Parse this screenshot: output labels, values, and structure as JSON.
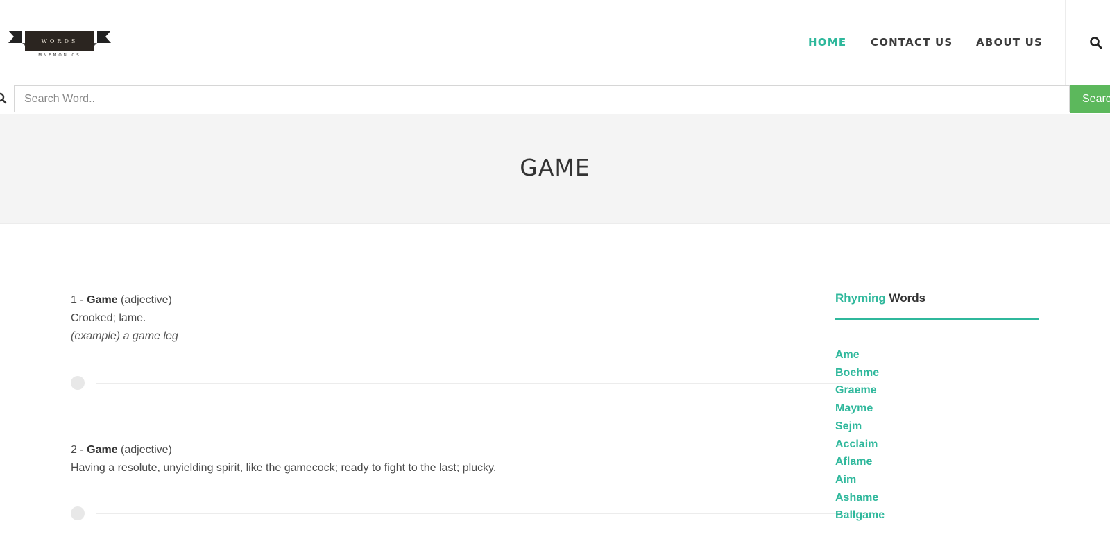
{
  "logo": {
    "top_text": "WORDS",
    "bottom_text": "MNEMONICS"
  },
  "nav": [
    {
      "label": "HOME",
      "active": true
    },
    {
      "label": "CONTACT US",
      "active": false
    },
    {
      "label": "ABOUT US",
      "active": false
    }
  ],
  "search": {
    "placeholder": "Search Word..",
    "button_label": "Search",
    "icon": "search-icon"
  },
  "page_title": "GAME",
  "definitions": [
    {
      "num_prefix": "1 - ",
      "word": "Game",
      "pos": " (adjective)",
      "meaning": "Crooked; lame.",
      "example": "(example) a game leg"
    },
    {
      "num_prefix": "2 - ",
      "word": "Game",
      "pos": " (adjective)",
      "meaning": "Having a resolute, unyielding spirit, like the gamecock; ready to fight to the last; plucky.",
      "example": ""
    }
  ],
  "sidebar": {
    "title_accent": "Rhyming",
    "title_rest": " Words",
    "rhymes": [
      "Ame",
      "Boehme",
      "Graeme",
      "Mayme",
      "Sejm",
      "Acclaim",
      "Aflame",
      "Aim",
      "Ashame",
      "Ballgame"
    ]
  },
  "colors": {
    "accent": "#2fb89c",
    "button": "#5cb85c",
    "band": "#f4f4f4"
  }
}
